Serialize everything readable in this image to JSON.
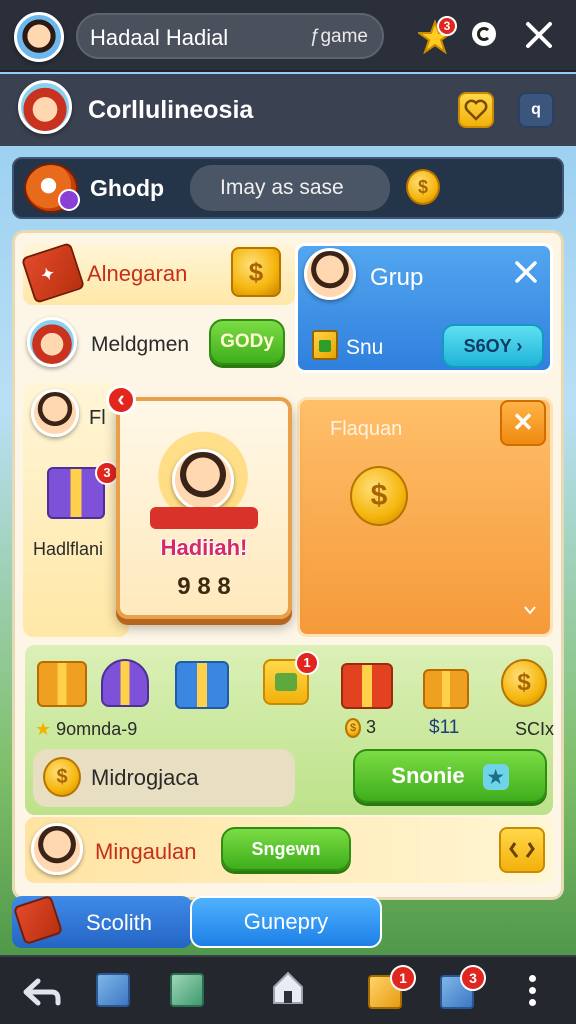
{
  "top_bar": {
    "search_text": "Hadaal Hadial",
    "search_suffix": "ƒgame",
    "notification_count": "3"
  },
  "header": {
    "title": "Corllulineosia"
  },
  "search_row": {
    "label": "Ghodp",
    "pill_text": "Imay as sase"
  },
  "panel": {
    "card1": {
      "title": "Alnegaran"
    },
    "member_row": {
      "name": "Meldgmen",
      "button": "GODу"
    },
    "group_card": {
      "title": "Grup",
      "item": "Snu",
      "button": "S6OY ›"
    },
    "fl_label": "Fl",
    "gift_label": "Hadlflani",
    "gift_badge": "3",
    "popup": {
      "title": "Hadiiah!",
      "digits": "9 8 8",
      "back_icon_text": "‹"
    },
    "orange_card": {
      "title": "Flaquan"
    },
    "rewards": {
      "badge": "1",
      "label_left": "9omnda-9",
      "val1": "3",
      "val2": "$11",
      "val3": "SCIx"
    },
    "midrow": {
      "label": "Midrogjaca",
      "button": "Snonie"
    },
    "bottom_row": {
      "label": "Mingaulan",
      "button": "Sngewn"
    }
  },
  "footer_row": {
    "label": "Scolith",
    "button": "Gunepry"
  },
  "bottom_bar": {
    "badge_left": "1",
    "badge_right": "3"
  },
  "colors": {
    "accent_green": "#3fae1c",
    "accent_blue": "#2f80dd",
    "accent_orange": "#f59a3a",
    "badge_red": "#e0261e"
  }
}
